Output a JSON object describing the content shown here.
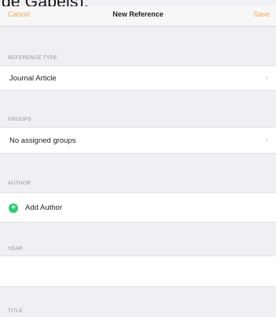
{
  "page_heading_fragment": "de Gabels);",
  "nav": {
    "cancel_label": "Cancel",
    "title": "New Reference",
    "save_label": "Save"
  },
  "sections": {
    "reference_type": {
      "header": "REFERENCE TYPE",
      "value": "Journal Article"
    },
    "groups": {
      "header": "GROUPS",
      "value": "No assigned groups"
    },
    "author": {
      "header": "AUTHOR",
      "add_label": "Add Author"
    },
    "year": {
      "header": "YEAR",
      "value": ""
    },
    "title": {
      "header": "TITLE"
    }
  },
  "icons": {
    "chevron": "chevron-right-icon",
    "add": "plus-circle-icon"
  },
  "colors": {
    "accent": "#f2a65a",
    "add_green": "#2ecc71",
    "background": "#efeff4"
  }
}
